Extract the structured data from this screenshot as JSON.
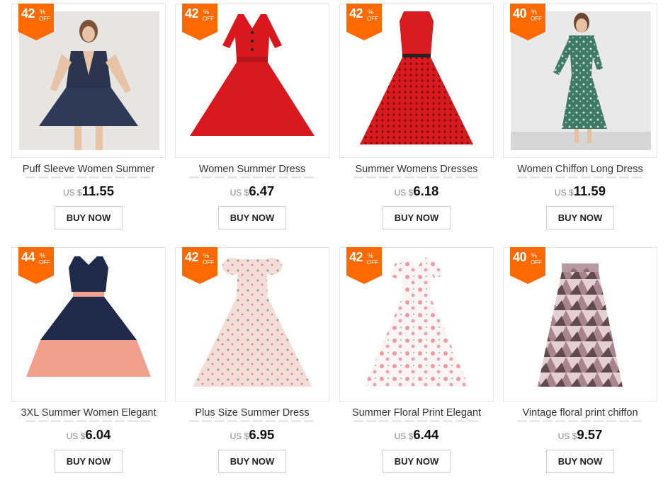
{
  "colors": {
    "badge": "#ff6a00",
    "price_text": "#111111",
    "currency": "#888888"
  },
  "products": [
    {
      "discount": "42",
      "percent": "%",
      "off": "OFF",
      "title": "Puff Sleeve Women Summer",
      "currency": "US $",
      "price": "11.55",
      "buy_label": "BUY NOW"
    },
    {
      "discount": "42",
      "percent": "%",
      "off": "OFF",
      "title": "Women Summer Dress",
      "currency": "US $",
      "price": "6.47",
      "buy_label": "BUY NOW"
    },
    {
      "discount": "42",
      "percent": "%",
      "off": "OFF",
      "title": "Summer Womens Dresses",
      "currency": "US $",
      "price": "6.18",
      "buy_label": "BUY NOW"
    },
    {
      "discount": "40",
      "percent": "%",
      "off": "OFF",
      "title": "Women Chiffon Long Dress",
      "currency": "US $",
      "price": "11.59",
      "buy_label": "BUY NOW"
    },
    {
      "discount": "44",
      "percent": "%",
      "off": "OFF",
      "title": "3XL Summer Women Elegant",
      "currency": "US $",
      "price": "6.04",
      "buy_label": "BUY NOW"
    },
    {
      "discount": "42",
      "percent": "%",
      "off": "OFF",
      "title": "Plus Size Summer Dress",
      "currency": "US $",
      "price": "6.95",
      "buy_label": "BUY NOW"
    },
    {
      "discount": "42",
      "percent": "%",
      "off": "OFF",
      "title": "Summer Floral Print Elegant",
      "currency": "US $",
      "price": "6.44",
      "buy_label": "BUY NOW"
    },
    {
      "discount": "40",
      "percent": "%",
      "off": "OFF",
      "title": "Vintage floral print chiffon",
      "currency": "US $",
      "price": "9.57",
      "buy_label": "BUY NOW"
    }
  ]
}
